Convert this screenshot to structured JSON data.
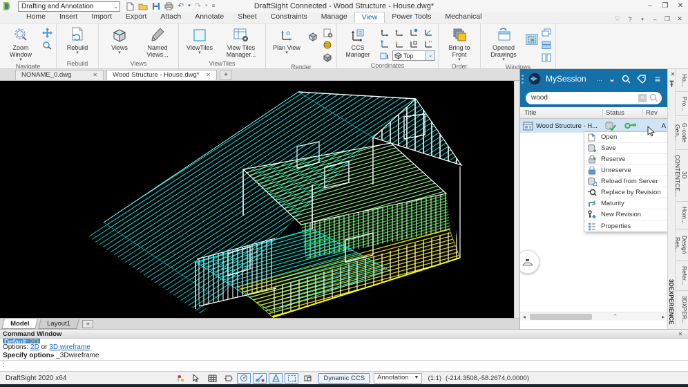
{
  "window": {
    "workspace": "Drafting and Annotation",
    "title": "DraftSight Connected - Wood Structure - House.dwg*"
  },
  "glyphs": {
    "caret": "▾",
    "chevron": "⌄",
    "close": "✕",
    "minimize": "–",
    "restore": "❐",
    "plus": "+",
    "heart": "♡",
    "help": "?",
    "hamburger": "≡",
    "ellipsis": "...",
    "undo": "↶",
    "redo": "↷",
    "left": "◂",
    "right": "▸",
    "up": "⌃",
    "down": "▼"
  },
  "menu_tabs": [
    "Home",
    "Insert",
    "Import",
    "Export",
    "Attach",
    "Annotate",
    "Sheet",
    "Constraints",
    "Manage",
    "View",
    "Power Tools",
    "Mechanical"
  ],
  "ribbon": {
    "navigate": {
      "label": "Navigate",
      "zoom_window": "Zoom Window"
    },
    "rebuild": {
      "label": "Rebuild",
      "rebuild": "Rebuild"
    },
    "views": {
      "label": "Views",
      "views": "Views",
      "named_views": "Named Views..."
    },
    "viewtiles": {
      "label": "ViewTiles",
      "viewtiles": "ViewTiles",
      "manager": "View Tiles Manager..."
    },
    "render": {
      "label": "Render",
      "plan_view": "Plan View"
    },
    "coordinates": {
      "label": "Coordinates",
      "ccs_manager": "CCS Manager",
      "view_select": "Top"
    },
    "order": {
      "label": "Order",
      "bring_to_front": "Bring to Front"
    },
    "windows": {
      "label": "Windows",
      "opened_drawings": "Opened Drawings"
    }
  },
  "doc_tabs": [
    "NONAME_0.dwg",
    "Wood Structure - House.dwg*"
  ],
  "session_panel": {
    "title": "MySession",
    "search_value": "wood",
    "columns": [
      "Title",
      "Status",
      "Rev"
    ],
    "row": {
      "title": "Wood Structure - H...",
      "rev": "A"
    },
    "menu": [
      "Open",
      "Save",
      "Reserve",
      "Unreserve",
      "Reload from Server",
      "Replace by Revision",
      "Maturity",
      "New Revision",
      "Properties"
    ]
  },
  "side_rail": {
    "brand": "3DEXPERIENCE",
    "tabs": [
      "Ho...",
      "Pro...",
      "G-code Gen...",
      "3D CONTENTCE...",
      "Hom...",
      "Design Res...",
      "Refer...",
      "3DXPER..."
    ]
  },
  "sheet_tabs": [
    "Model",
    "Layout1"
  ],
  "command_window": {
    "title": "Command Window",
    "default_label": "Default:",
    "default_value": "2D",
    "options_prefix": "Options:",
    "option_2d": "2D",
    "options_mid": "or",
    "option_3d": "3D wireframe",
    "specify_bold": "Specify option»",
    "specify_value": "_3Dwireframe",
    "prompt": ":"
  },
  "status_bar": {
    "app_version": "DraftSight 2020 x64",
    "dynamic_ccs": "Dynamic CCS",
    "annotation": "Annotation",
    "scale": "(1:1)",
    "coordinates": "(-214.3508,-58.2674,0.0000)"
  },
  "colors": {
    "accent_blue": "#1470a8",
    "selection": "#cfe4f7",
    "wire_cyan": "#00e5e5",
    "wire_green": "#33cc33",
    "wire_yellow": "#f2e700"
  }
}
